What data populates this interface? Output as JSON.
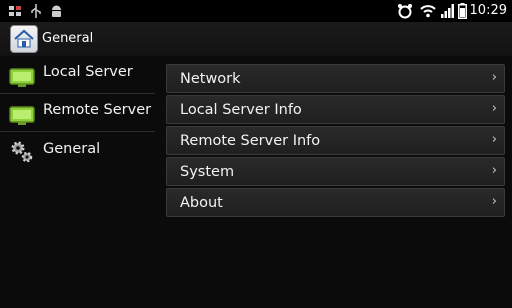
{
  "statusbar": {
    "time": "10:29"
  },
  "actionbar": {
    "title": "General"
  },
  "sidebar": {
    "items": [
      {
        "label": "Local Server",
        "icon": "monitor-icon"
      },
      {
        "label": "Remote Server",
        "icon": "monitor-icon"
      },
      {
        "label": "General",
        "icon": "gears-icon"
      }
    ]
  },
  "settings": {
    "items": [
      {
        "label": "Network"
      },
      {
        "label": "Local Server Info"
      },
      {
        "label": "Remote Server Info"
      },
      {
        "label": "System"
      },
      {
        "label": "About"
      }
    ]
  },
  "colors": {
    "accent_green": "#8fd13b",
    "background": "#0b0b0b"
  }
}
